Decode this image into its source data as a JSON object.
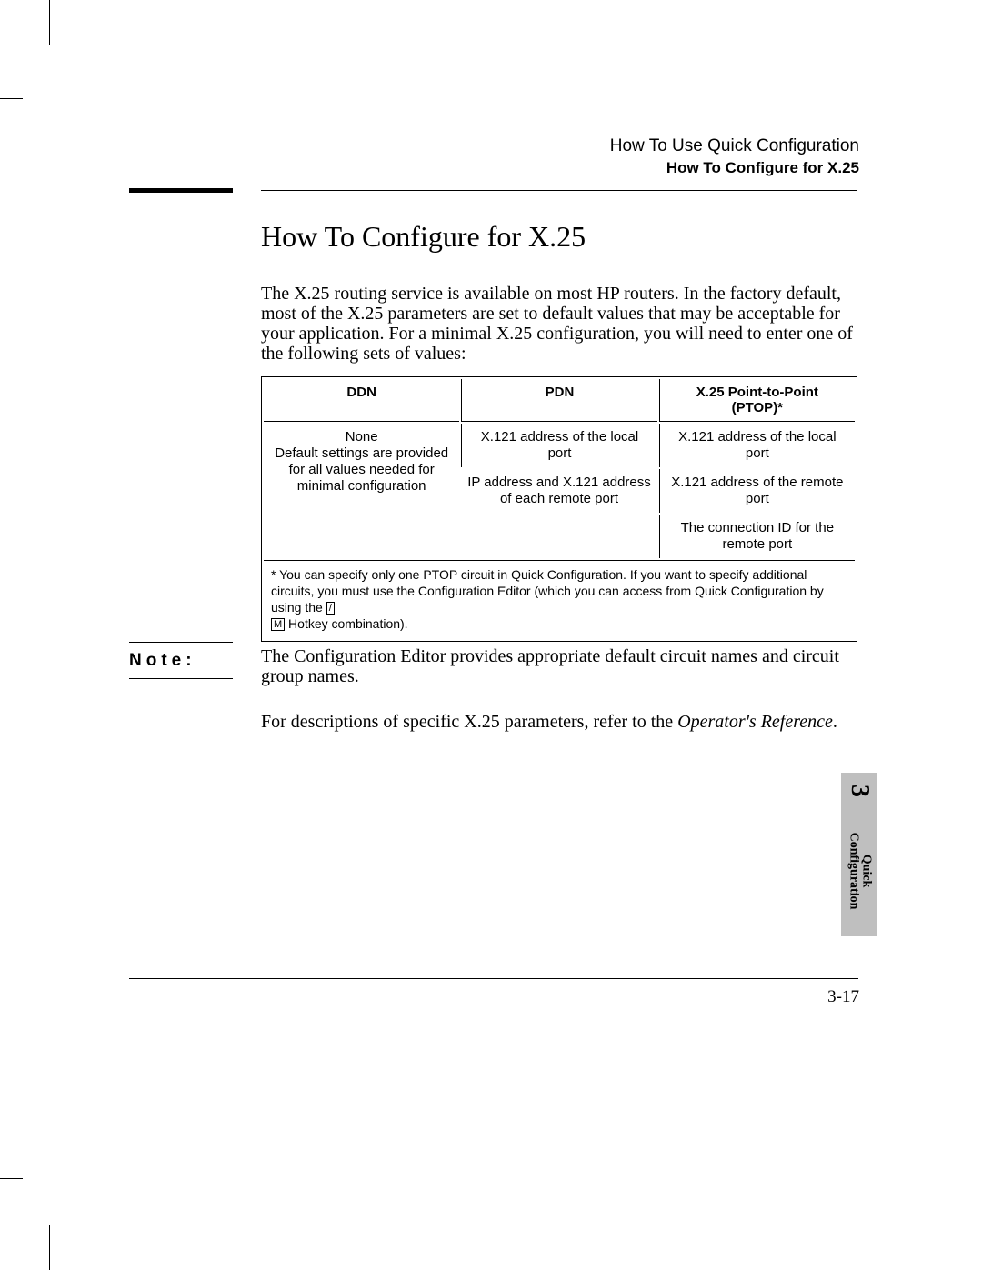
{
  "header": {
    "line1": "How To Use Quick Configuration",
    "line2": "How To Configure for X.25"
  },
  "title": "How To Configure for X.25",
  "intro": "The X.25 routing service is available on most HP routers. In the factory default, most of the X.25 parameters are set to default values that may be acceptable for your application. For a minimal X.25 configuration, you will need to enter one of the following sets of values:",
  "table": {
    "headers": {
      "c1": "DDN",
      "c2": "PDN",
      "c3a": "X.25 Point-to-Point",
      "c3b": "(PTOP)*"
    },
    "rows": {
      "r1c1a": "None",
      "r1c1b": "Default settings are provided for all values needed for minimal configuration",
      "r1c2": "X.121 address of the local port",
      "r1c3": "X.121 address of the local port",
      "r2c2": "IP address and X.121 address of each remote port",
      "r2c3": "X.121 address of the remote port",
      "r3c3": "The connection ID for the remote port"
    },
    "footnote": {
      "star": "*",
      "t1": " You can specify only one PTOP circuit in Quick Configuration. If you want to specify additional circuits, you must use the Configuration Editor (which you can access from Quick Configuration by using the ",
      "key1": "/",
      "slash": " ",
      "key2": "M",
      "t2": " Hotkey combination)."
    }
  },
  "note": {
    "label": "Note:",
    "text": "The Configuration Editor provides appropriate default circuit names and circuit group names."
  },
  "ref": {
    "t1": "For descriptions of specific X.25 parameters, refer to the ",
    "italic": "Operator's Reference",
    "t2": "."
  },
  "sidetab": {
    "chapter": "3",
    "line1": "Quick",
    "line2": "Configuration"
  },
  "pagenum": "3-17"
}
